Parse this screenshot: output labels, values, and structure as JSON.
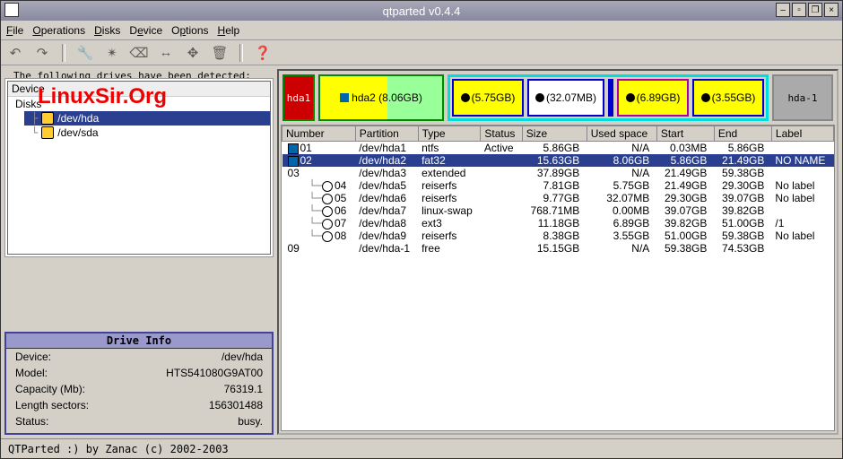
{
  "window": {
    "title": "qtparted v0.4.4"
  },
  "menubar": [
    "File",
    "Operations",
    "Disks",
    "Device",
    "Options",
    "Help"
  ],
  "drives_panel": {
    "title": "The following drives have been detected:",
    "header": "Device",
    "root": "Disks",
    "items": [
      {
        "label": "/dev/hda",
        "selected": true
      },
      {
        "label": "/dev/sda",
        "selected": false
      }
    ],
    "watermark": "LinuxSir.Org"
  },
  "drive_info": {
    "title": "Drive Info",
    "rows": [
      {
        "k": "Device:",
        "v": "/dev/hda"
      },
      {
        "k": "Model:",
        "v": "HTS541080G9AT00"
      },
      {
        "k": "Capacity (Mb):",
        "v": "76319.1"
      },
      {
        "k": "Length sectors:",
        "v": "156301488"
      },
      {
        "k": "Status:",
        "v": "busy."
      }
    ]
  },
  "partition_bar": {
    "hda1": "hda1",
    "hda2": "hda2 (8.06GB)",
    "ext": [
      "(5.75GB)",
      "(32.07MB)",
      "(6.89GB)",
      "(3.55GB)"
    ],
    "free": "hda-1"
  },
  "columns": [
    "Number",
    "Partition",
    "Type",
    "Status",
    "Size",
    "Used space",
    "Start",
    "End",
    "Label"
  ],
  "rows": [
    {
      "ic": "win",
      "num": "01",
      "part": "/dev/hda1",
      "type": "ntfs",
      "status": "Active",
      "size": "5.86GB",
      "used": "N/A",
      "start": "0.03MB",
      "end": "5.86GB",
      "label": ""
    },
    {
      "ic": "win",
      "num": "02",
      "part": "/dev/hda2",
      "type": "fat32",
      "status": "",
      "size": "15.63GB",
      "used": "8.06GB",
      "start": "5.86GB",
      "end": "21.49GB",
      "label": "NO NAME",
      "sel": true
    },
    {
      "ic": "",
      "num": "03",
      "part": "/dev/hda3",
      "type": "extended",
      "status": "",
      "size": "37.89GB",
      "used": "N/A",
      "start": "21.49GB",
      "end": "59.38GB",
      "label": ""
    },
    {
      "ic": "tux",
      "num": "04",
      "part": "/dev/hda5",
      "type": "reiserfs",
      "status": "",
      "size": "7.81GB",
      "used": "5.75GB",
      "start": "21.49GB",
      "end": "29.30GB",
      "label": "No label",
      "ind": 1
    },
    {
      "ic": "tux",
      "num": "05",
      "part": "/dev/hda6",
      "type": "reiserfs",
      "status": "",
      "size": "9.77GB",
      "used": "32.07MB",
      "start": "29.30GB",
      "end": "39.07GB",
      "label": "No label",
      "ind": 1
    },
    {
      "ic": "tux",
      "num": "06",
      "part": "/dev/hda7",
      "type": "linux-swap",
      "status": "",
      "size": "768.71MB",
      "used": "0.00MB",
      "start": "39.07GB",
      "end": "39.82GB",
      "label": "",
      "ind": 1
    },
    {
      "ic": "tux",
      "num": "07",
      "part": "/dev/hda8",
      "type": "ext3",
      "status": "",
      "size": "11.18GB",
      "used": "6.89GB",
      "start": "39.82GB",
      "end": "51.00GB",
      "label": "/1",
      "ind": 1
    },
    {
      "ic": "tux",
      "num": "08",
      "part": "/dev/hda9",
      "type": "reiserfs",
      "status": "",
      "size": "8.38GB",
      "used": "3.55GB",
      "start": "51.00GB",
      "end": "59.38GB",
      "label": "No label",
      "ind": 1
    },
    {
      "ic": "",
      "num": "09",
      "part": "/dev/hda-1",
      "type": "free",
      "status": "",
      "size": "15.15GB",
      "used": "N/A",
      "start": "59.38GB",
      "end": "74.53GB",
      "label": ""
    }
  ],
  "statusbar": "QTParted :)  by Zanac (c) 2002-2003"
}
